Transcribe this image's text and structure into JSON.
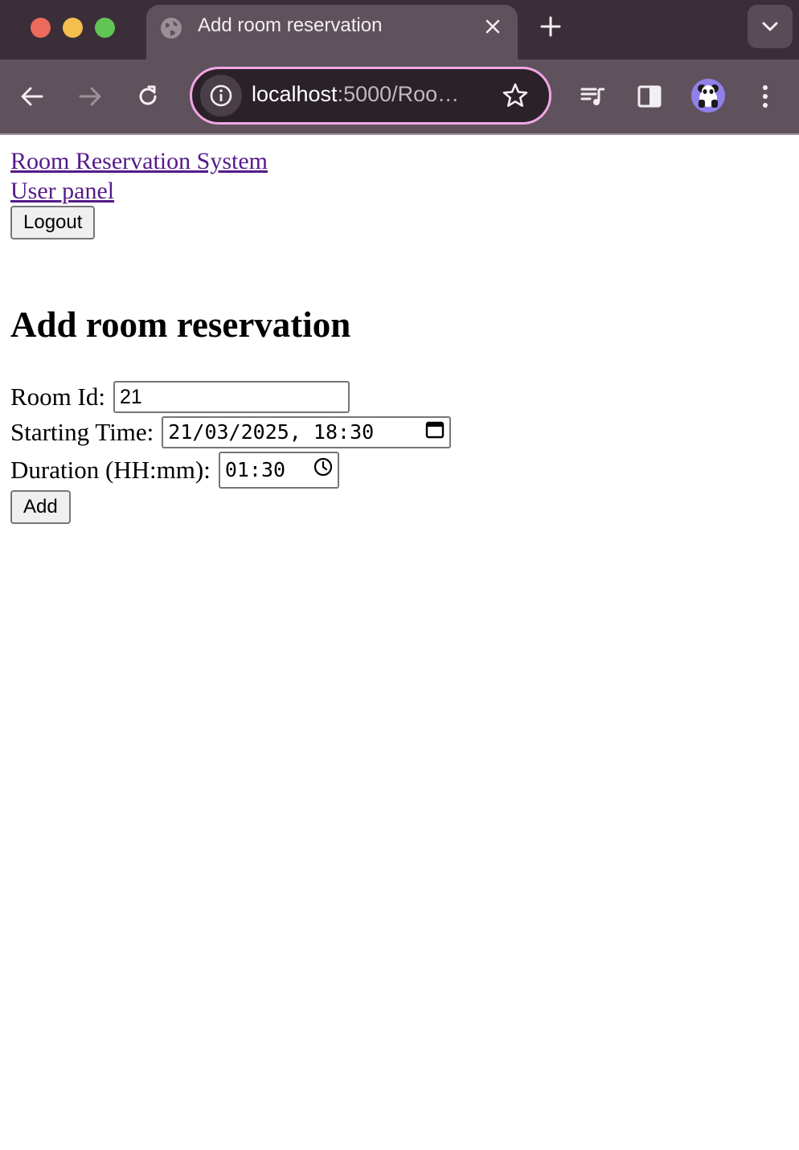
{
  "browser": {
    "tab_title": "Add room reservation",
    "url_host": "localhost",
    "url_path": ":5000/Roo…"
  },
  "nav": {
    "home_link": "Room Reservation System",
    "user_panel_link": "User panel",
    "logout_label": "Logout"
  },
  "page": {
    "heading": "Add room reservation"
  },
  "form": {
    "room_id_label": "Room Id:",
    "room_id_value": "21",
    "start_label": "Starting Time:",
    "start_value": "21/03/2025, 18:30",
    "duration_label": "Duration (HH:mm):",
    "duration_value": "01:30",
    "add_label": "Add"
  },
  "colors": {
    "tabbar": "#3b2e38",
    "toolbar": "#5f525c",
    "omnibox_border": "#f1a6e6",
    "link": "#551a8b"
  }
}
